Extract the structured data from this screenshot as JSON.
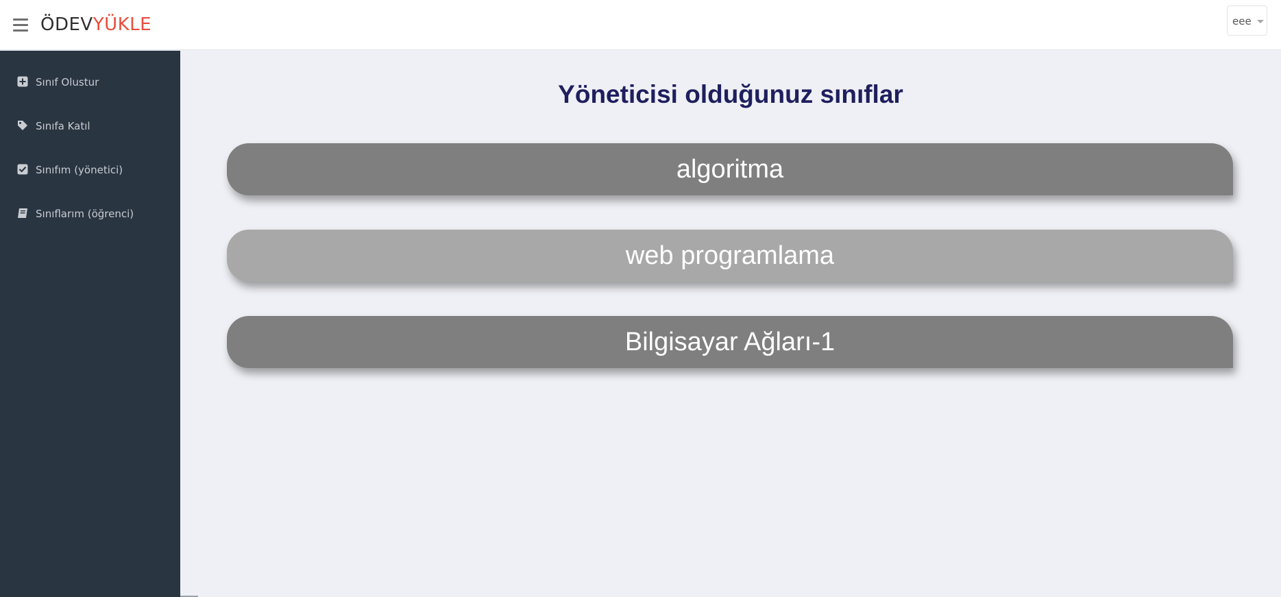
{
  "header": {
    "logo_part1": "ÖDEV",
    "logo_part2": "YÜKLE",
    "user_name": "eee",
    "logo_colors": {
      "part1": "#2f2f2f",
      "part2": "#e84c3d"
    }
  },
  "sidebar": {
    "items": [
      {
        "label": "Sınıf Olustur",
        "icon": "plus-square-icon"
      },
      {
        "label": "Sınıfa Katıl",
        "icon": "tag-icon"
      },
      {
        "label": "Sınıfım (yönetici)",
        "icon": "check-square-icon"
      },
      {
        "label": "Sınıflarım (öğrenci)",
        "icon": "book-icon"
      }
    ]
  },
  "main": {
    "heading": "Yöneticisi olduğunuz sınıflar",
    "classes": [
      {
        "name": "algoritma",
        "color": "#7f7f7f"
      },
      {
        "name": "web programlama",
        "color": "#a8a8a8"
      },
      {
        "name": "Bilgisayar Ağları-1",
        "color": "#7f7f7f"
      }
    ]
  },
  "colors": {
    "sidebar_bg": "#2a3542",
    "page_bg": "#eff0f5",
    "heading": "#1f1f5e"
  }
}
